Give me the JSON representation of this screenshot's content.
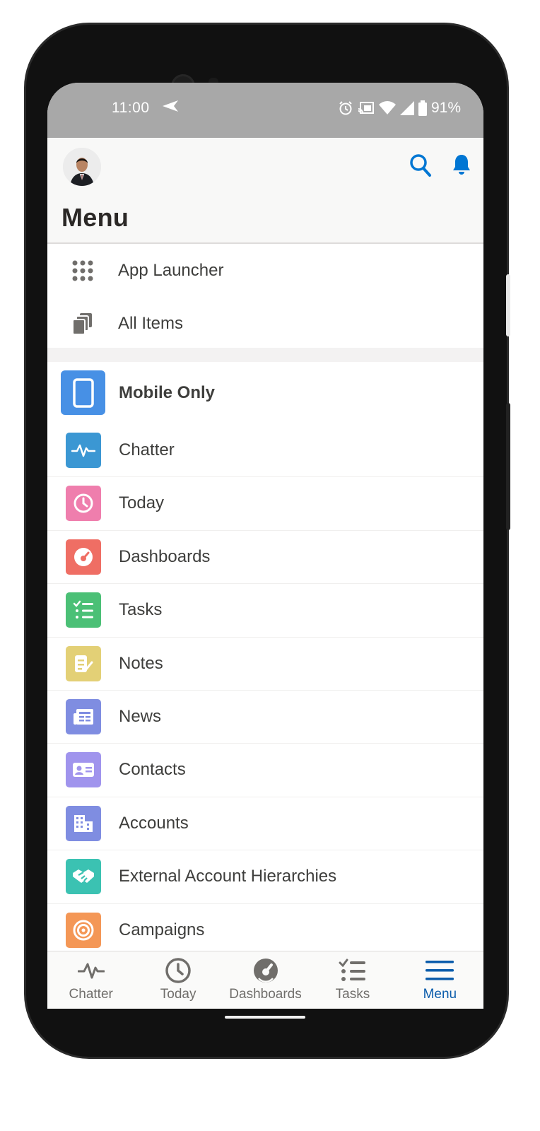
{
  "status_bar": {
    "time": "11:00",
    "battery": "91%",
    "icons": [
      "send-icon",
      "alarm-icon",
      "cast-icon",
      "wifi-icon",
      "signal-icon",
      "battery-icon"
    ]
  },
  "header": {
    "title": "Menu",
    "icons": [
      "avatar",
      "search-icon",
      "bell-icon"
    ],
    "accent": "#0176d3"
  },
  "utilities": [
    {
      "label": "App Launcher",
      "icon": "app-launcher-icon"
    },
    {
      "label": "All Items",
      "icon": "all-items-icon"
    }
  ],
  "section": {
    "label": "Mobile Only",
    "icon": "mobile-icon",
    "color": "#4790e5"
  },
  "nav_items": [
    {
      "label": "Chatter",
      "icon": "chatter-icon",
      "color": "#3b97d3"
    },
    {
      "label": "Today",
      "icon": "clock-icon",
      "color": "#ef7ead"
    },
    {
      "label": "Dashboards",
      "icon": "dashboard-gauge-icon",
      "color": "#ef6e64"
    },
    {
      "label": "Tasks",
      "icon": "tasks-checklist-icon",
      "color": "#4bc076"
    },
    {
      "label": "Notes",
      "icon": "notes-icon",
      "color": "#e3d076"
    },
    {
      "label": "News",
      "icon": "news-icon",
      "color": "#7f8de1"
    },
    {
      "label": "Contacts",
      "icon": "contact-card-icon",
      "color": "#a094ed"
    },
    {
      "label": "Accounts",
      "icon": "building-icon",
      "color": "#7f8de1"
    },
    {
      "label": "External Account Hierarchies",
      "icon": "handshake-icon",
      "color": "#3bc2b2"
    },
    {
      "label": "Campaigns",
      "icon": "target-icon",
      "color": "#f49756"
    }
  ],
  "tab_bar": {
    "active_color": "#0b5cab",
    "inactive_color": "#706e6b",
    "tabs": [
      {
        "label": "Chatter",
        "icon": "chatter-icon",
        "active": false
      },
      {
        "label": "Today",
        "icon": "clock-icon",
        "active": false
      },
      {
        "label": "Dashboards",
        "icon": "dashboard-gauge-icon",
        "active": false
      },
      {
        "label": "Tasks",
        "icon": "tasks-checklist-icon",
        "active": false
      },
      {
        "label": "Menu",
        "icon": "hamburger-menu-icon",
        "active": true
      }
    ]
  }
}
